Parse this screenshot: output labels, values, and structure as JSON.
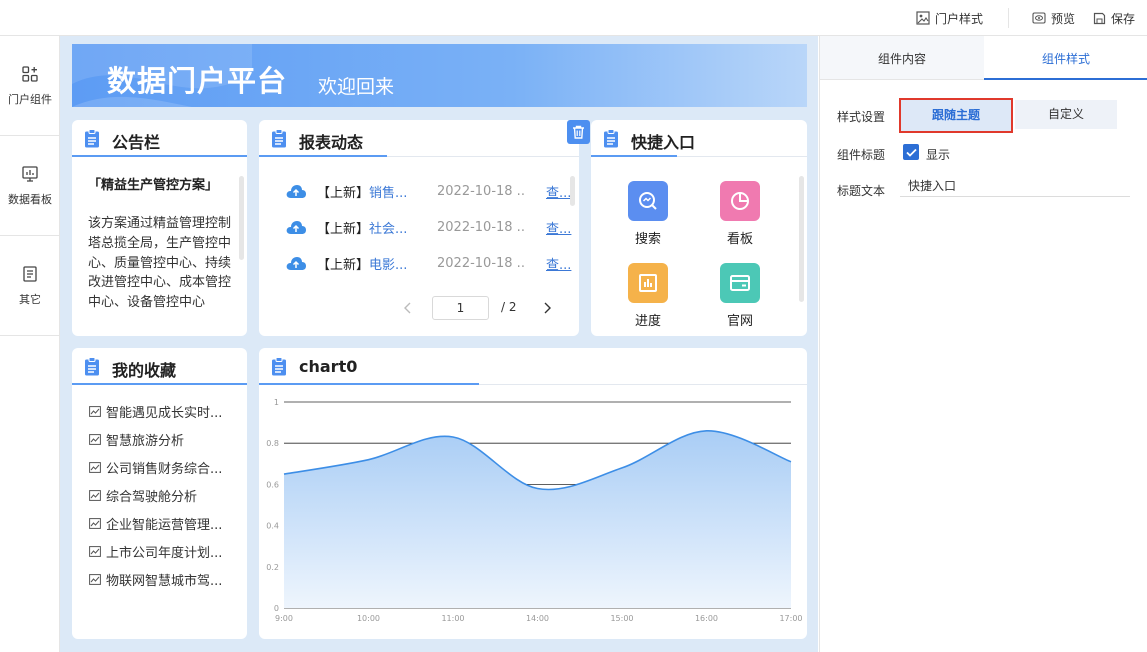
{
  "topbar": {
    "style_label": "门户样式",
    "preview_label": "预览",
    "save_label": "保存"
  },
  "rail": [
    {
      "label": "门户组件",
      "icon": "widgets-icon"
    },
    {
      "label": "数据看板",
      "icon": "dashboard-icon"
    },
    {
      "label": "其它",
      "icon": "document-icon"
    }
  ],
  "banner": {
    "title": "数据门户平台",
    "subtitle": "欢迎回来"
  },
  "notice": {
    "title": "公告栏",
    "item_title": "「精益生产管控方案」",
    "item_body": "该方案通过精益管理控制塔总揽全局，生产管控中心、质量管控中心、持续改进管控中心、成本管控中心、设备管控中心"
  },
  "report": {
    "title": "报表动态",
    "rows": [
      {
        "tag": "【上新】",
        "name": "销售...",
        "date": "2022-10-18 ...",
        "view": "查..."
      },
      {
        "tag": "【上新】",
        "name": "社会...",
        "date": "2022-10-18 ...",
        "view": "查..."
      },
      {
        "tag": "【上新】",
        "name": "电影...",
        "date": "2022-10-18 ...",
        "view": "查..."
      }
    ],
    "page": "1",
    "total": "/ 2"
  },
  "quick": {
    "title": "快捷入口",
    "items": [
      {
        "label": "搜索",
        "color": "#5b8ef0"
      },
      {
        "label": "看板",
        "color": "#f07ab0"
      },
      {
        "label": "进度",
        "color": "#f5b24a"
      },
      {
        "label": "官网",
        "color": "#4cc8b6"
      }
    ]
  },
  "favorites": {
    "title": "我的收藏",
    "items": [
      "智能遇见成长实时...",
      "智慧旅游分析",
      "公司销售财务综合...",
      "综合驾驶舱分析",
      "企业智能运营管理...",
      "上市公司年度计划...",
      "物联网智慧城市驾..."
    ]
  },
  "chart_card": {
    "title": "chart0"
  },
  "chart_data": {
    "type": "area",
    "title": "chart0",
    "x": [
      "9:00",
      "10:00",
      "11:00",
      "14:00",
      "15:00",
      "16:00",
      "17:00"
    ],
    "values": [
      0.65,
      0.72,
      0.83,
      0.58,
      0.68,
      0.86,
      0.71
    ],
    "y_ticks": [
      "0",
      "0.2",
      "0.4",
      "0.6",
      "0.8",
      "1"
    ],
    "ylim": [
      0,
      1
    ],
    "grid": true,
    "color": "#3d8ee6"
  },
  "panel": {
    "tabs": [
      "组件内容",
      "组件样式"
    ],
    "active_tab": 1,
    "style_setting_label": "样式设置",
    "follow_theme_label": "跟随主题",
    "custom_label": "自定义",
    "component_title_label": "组件标题",
    "show_label": "显示",
    "title_text_label": "标题文本",
    "title_text_value": "快捷入口"
  },
  "colors": {
    "accent": "#2c6ed5",
    "highlight": "#e0392c",
    "canvas_bg": "#dce9f7"
  }
}
